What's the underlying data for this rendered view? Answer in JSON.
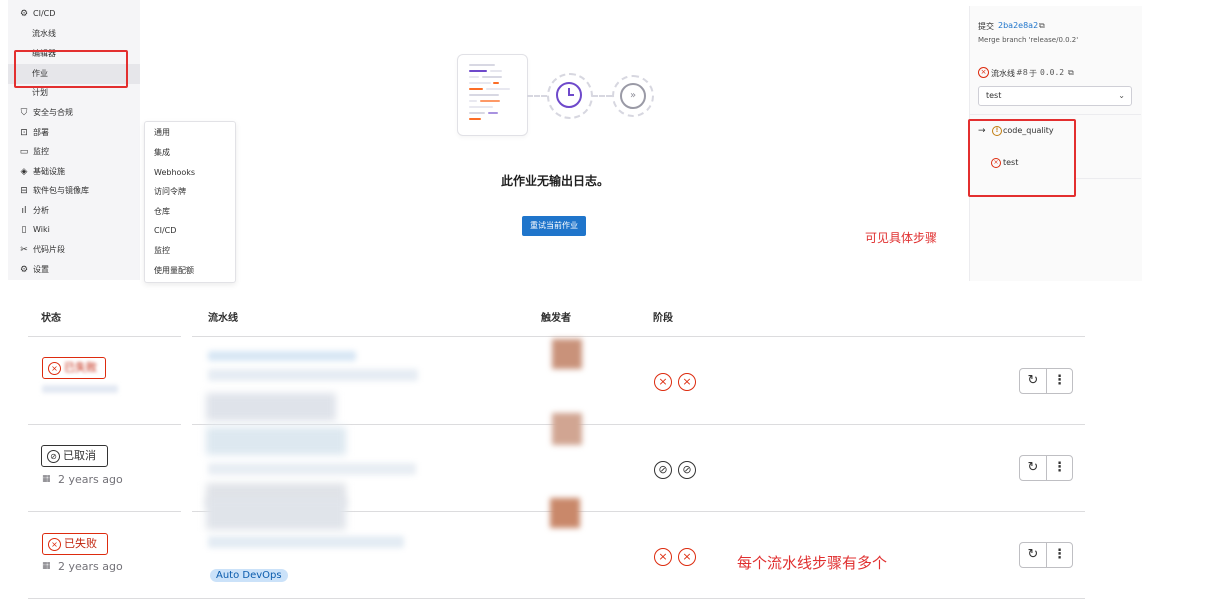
{
  "sidebar": {
    "items": [
      {
        "icon": "rocket-icon",
        "glyph": "⚙",
        "label": "CI/CD"
      },
      {
        "label": "流水线"
      },
      {
        "label": "编辑器"
      },
      {
        "label": "作业"
      },
      {
        "label": "计划"
      },
      {
        "icon": "shield-icon",
        "glyph": "⛉",
        "label": "安全与合规"
      },
      {
        "icon": "deploy-icon",
        "glyph": "⊡",
        "label": "部署"
      },
      {
        "icon": "monitor-icon",
        "glyph": "▭",
        "label": "监控"
      },
      {
        "icon": "infrastructure-icon",
        "glyph": "◈",
        "label": "基础设施"
      },
      {
        "icon": "package-icon",
        "glyph": "⊟",
        "label": "软件包与镜像库"
      },
      {
        "icon": "analytics-icon",
        "glyph": "ıl",
        "label": "分析"
      },
      {
        "icon": "wiki-icon",
        "glyph": "▯",
        "label": "Wiki"
      },
      {
        "icon": "snippet-icon",
        "glyph": "✂",
        "label": "代码片段"
      },
      {
        "icon": "settings-icon",
        "glyph": "⚙",
        "label": "设置"
      }
    ]
  },
  "flyout": {
    "items": [
      "通用",
      "集成",
      "Webhooks",
      "访问令牌",
      "仓库",
      "CI/CD",
      "监控",
      "使用量配额"
    ]
  },
  "job": {
    "empty_title": "此作业无输出日志。",
    "retry_label": "重试当前作业"
  },
  "annotation_top": "可见具体步骤",
  "annotation_bottom": "每个流水线步骤有多个",
  "right_panel": {
    "commit_label": "提交",
    "commit_sha": "2ba2e8a2",
    "commit_message": "Merge branch 'release/0.0.2'",
    "pipeline_label": "流水线",
    "pipeline_number": "#8",
    "pipeline_for": "于",
    "pipeline_ref": "0.0.2",
    "stage_selected": "test",
    "jobs": [
      {
        "name": "code_quality",
        "arrow": "→"
      },
      {
        "name": "test"
      }
    ]
  },
  "table": {
    "headers": {
      "status": "状态",
      "pipeline": "流水线",
      "triggerer": "触发者",
      "stages": "阶段"
    },
    "rows": [
      {
        "status": "已失败",
        "time": "",
        "stages": [
          "failed",
          "failed"
        ]
      },
      {
        "status": "已取消",
        "time": "2 years ago",
        "stages": [
          "canceled",
          "canceled"
        ]
      },
      {
        "status": "已失败",
        "time": "2 years ago",
        "stages": [
          "failed",
          "failed"
        ],
        "tag": "Auto DevOps"
      }
    ]
  },
  "colors": {
    "accent": "#1f75cb",
    "danger": "#dd2b0e",
    "annotation": "#e03030"
  }
}
